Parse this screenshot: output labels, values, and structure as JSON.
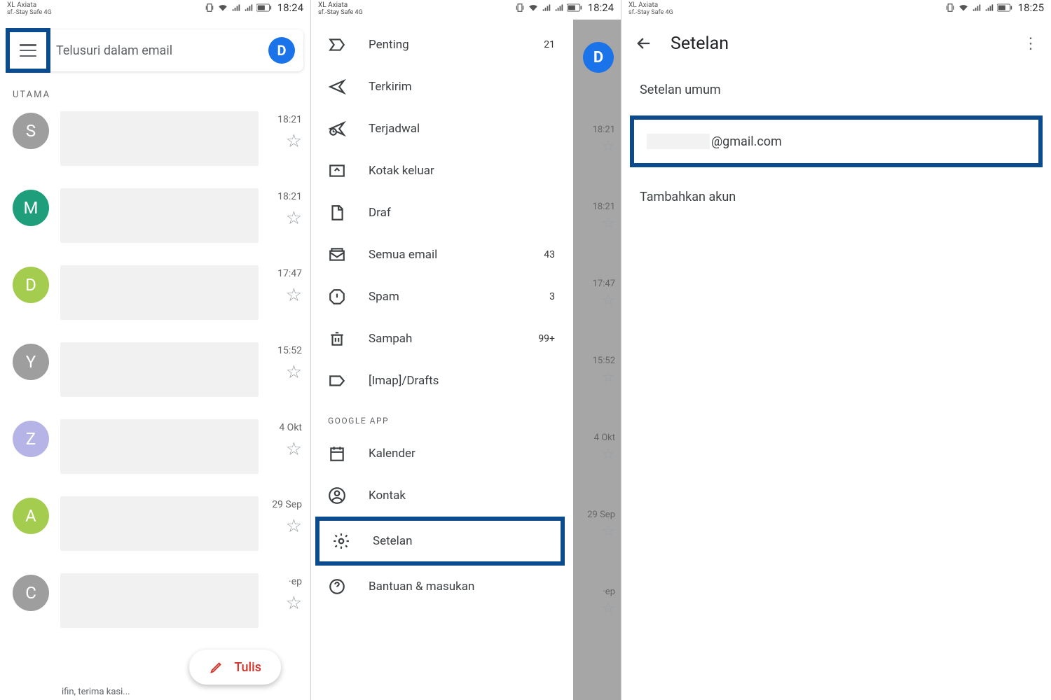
{
  "status": {
    "carrier": "XL Axiata",
    "sub": "sf.-Stay Safe 4G",
    "time1": "18:24",
    "time2": "18:24",
    "time3": "18:25"
  },
  "panel1": {
    "search_placeholder": "Telusuri dalam email",
    "avatar_letter": "D",
    "section": "UTAMA",
    "rows": [
      {
        "letter": "S",
        "color": "#9e9e9e",
        "time": "18:21"
      },
      {
        "letter": "M",
        "color": "#1e9e7a",
        "time": "18:21"
      },
      {
        "letter": "D",
        "color": "#a4cc4e",
        "time": "17:47"
      },
      {
        "letter": "Y",
        "color": "#9e9e9e",
        "time": "15:52"
      },
      {
        "letter": "Z",
        "color": "#b6b3e6",
        "time": "4 Okt"
      },
      {
        "letter": "A",
        "color": "#a4cc4e",
        "time": "29 Sep"
      },
      {
        "letter": "C",
        "color": "#9e9e9e",
        "time": "·ep"
      }
    ],
    "snippet": "ifin, terima kasi...",
    "fab_label": "Tulis"
  },
  "panel2": {
    "items": [
      {
        "icon": "important",
        "label": "Penting",
        "count": "21"
      },
      {
        "icon": "sent",
        "label": "Terkirim",
        "count": ""
      },
      {
        "icon": "scheduled",
        "label": "Terjadwal",
        "count": ""
      },
      {
        "icon": "outbox",
        "label": "Kotak keluar",
        "count": ""
      },
      {
        "icon": "draft",
        "label": "Draf",
        "count": ""
      },
      {
        "icon": "allmail",
        "label": "Semua email",
        "count": "43"
      },
      {
        "icon": "spam",
        "label": "Spam",
        "count": "3"
      },
      {
        "icon": "trash",
        "label": "Sampah",
        "count": "99+"
      },
      {
        "icon": "label",
        "label": "[Imap]/Drafts",
        "count": ""
      }
    ],
    "heading": "GOOGLE APP",
    "apps": [
      {
        "icon": "calendar",
        "label": "Kalender"
      },
      {
        "icon": "contacts",
        "label": "Kontak"
      }
    ],
    "setelan": "Setelan",
    "help": "Bantuan & masukan",
    "bg_letter": "D",
    "bg_rows": [
      {
        "time": "18:21"
      },
      {
        "time": "18:21"
      },
      {
        "time": "17:47"
      },
      {
        "time": "15:52"
      },
      {
        "time": "4 Okt"
      },
      {
        "time": "29 Sep"
      },
      {
        "time": "·ep"
      }
    ]
  },
  "panel3": {
    "title": "Setelan",
    "general": "Setelan umum",
    "account_suffix": "@gmail.com",
    "add": "Tambahkan akun"
  }
}
